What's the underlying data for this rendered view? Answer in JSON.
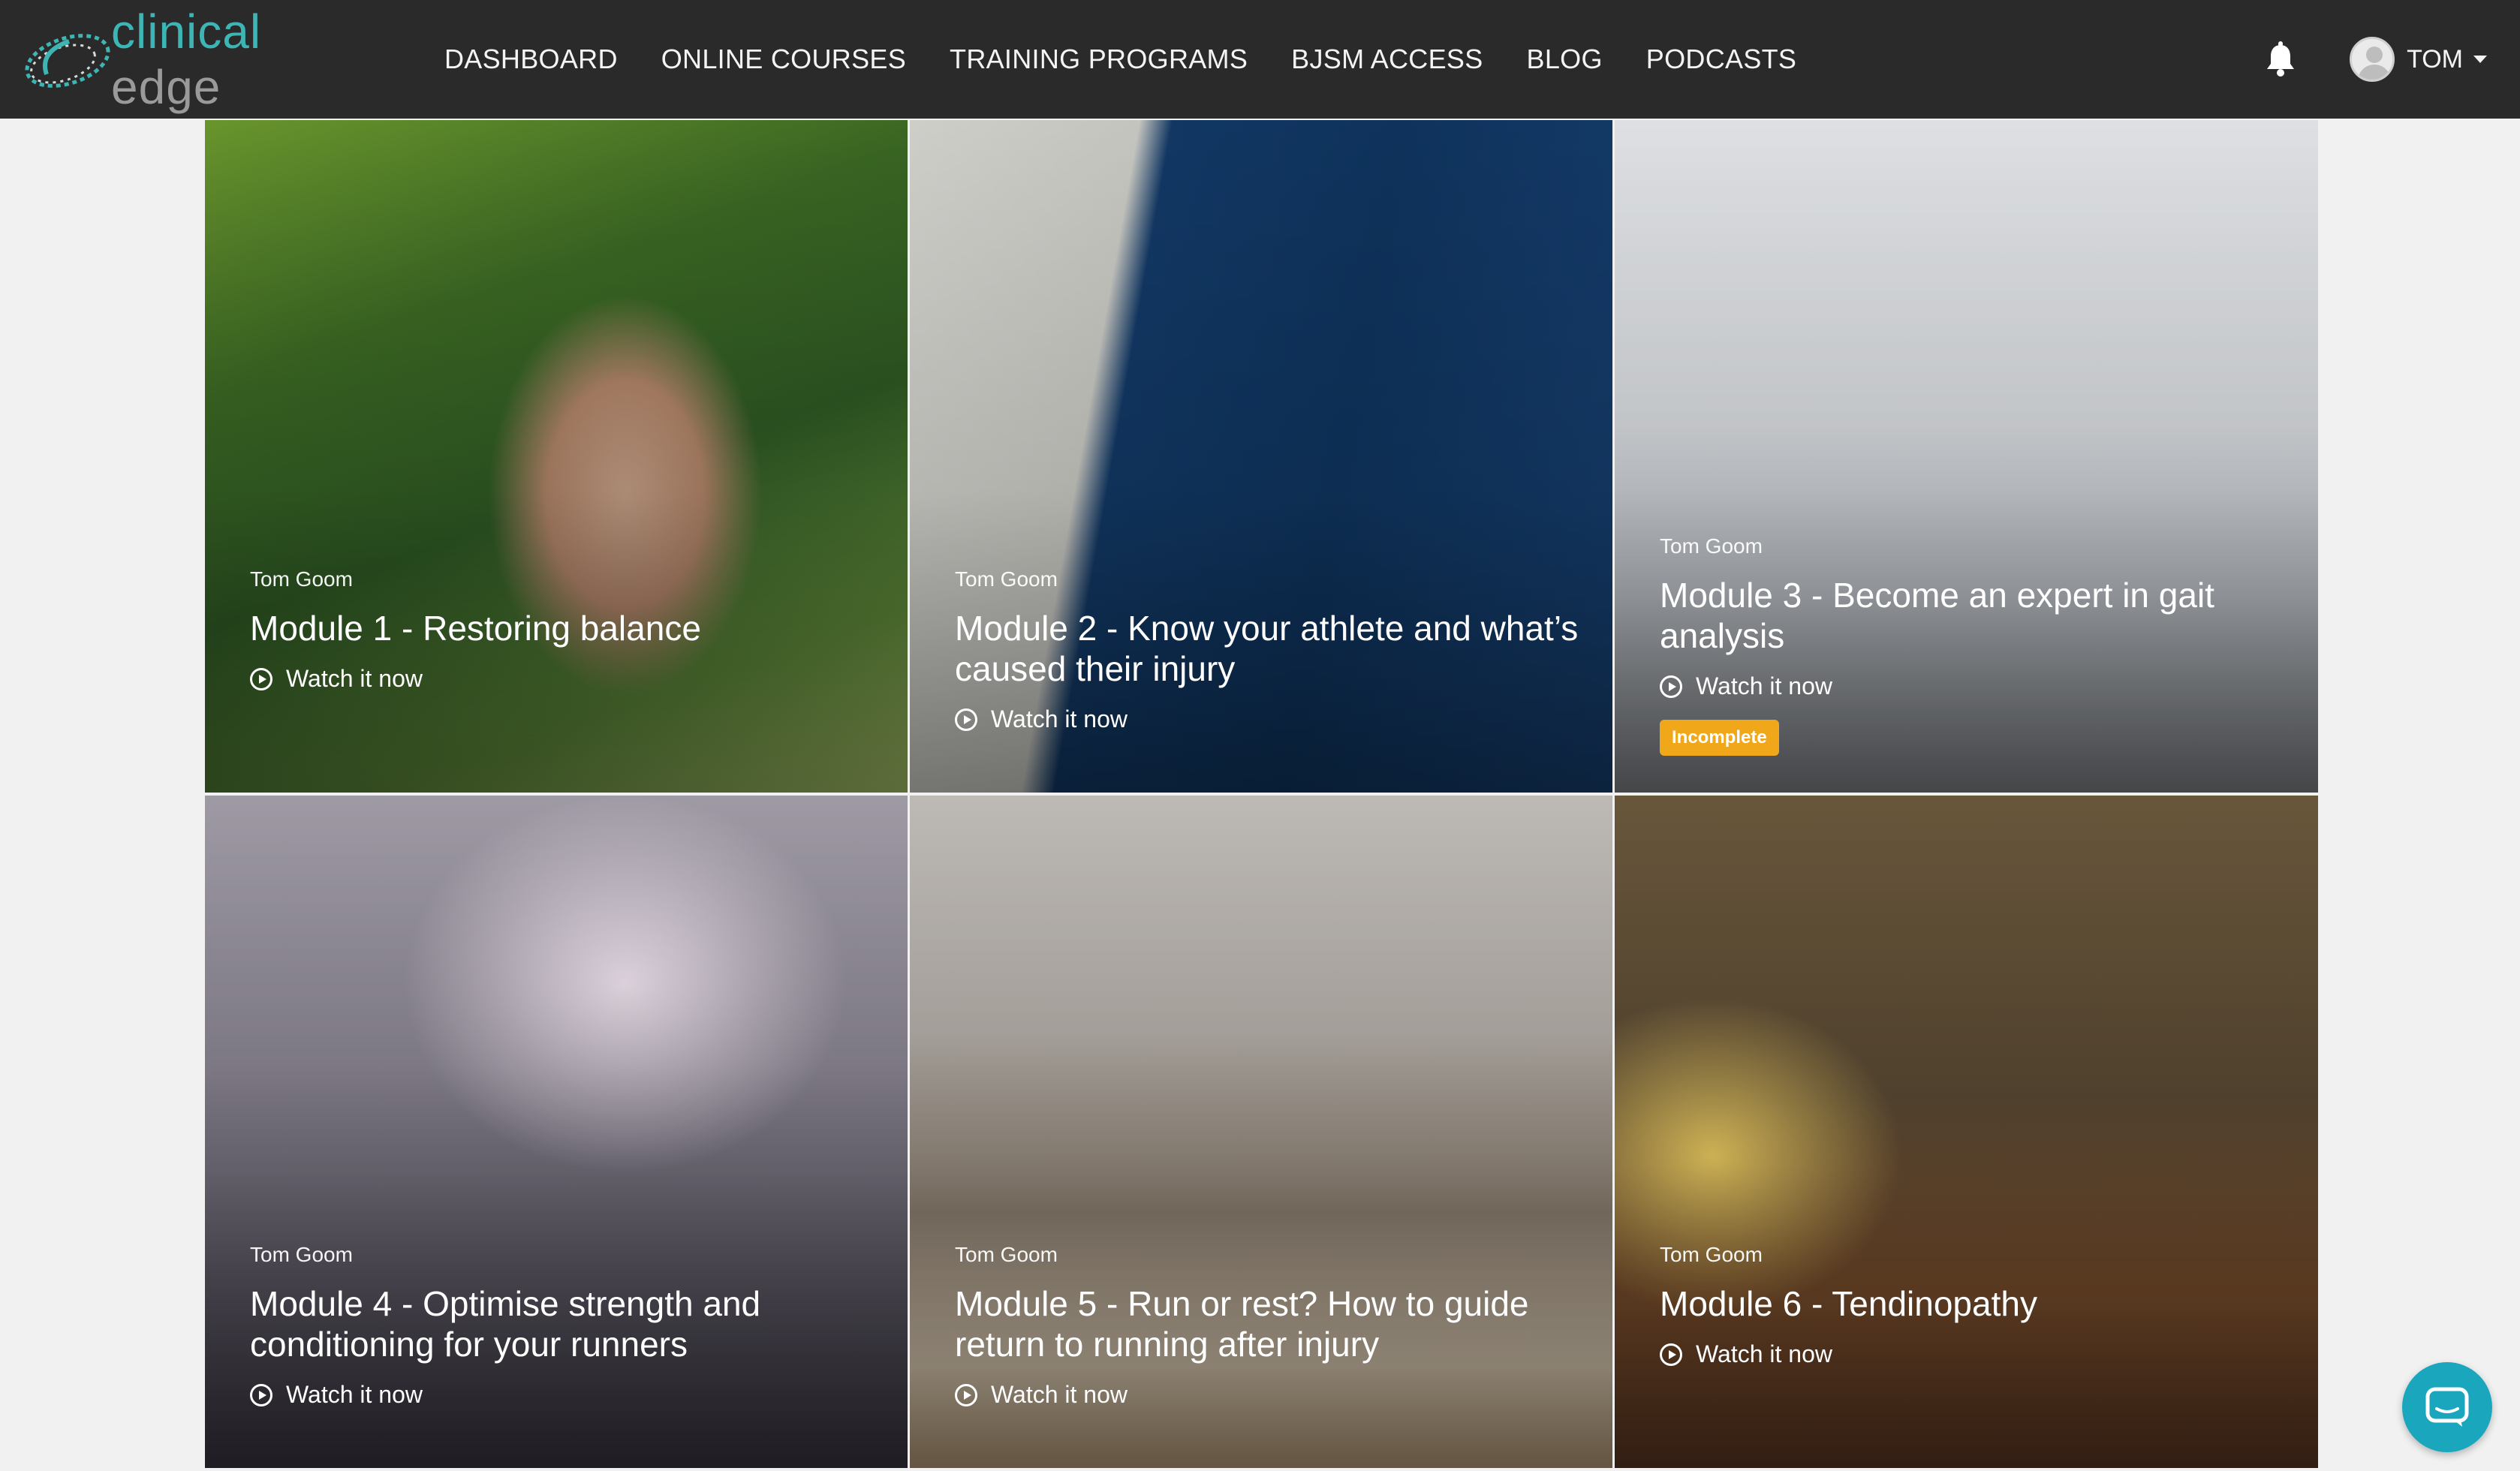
{
  "brand": {
    "name_primary": "clinical",
    "name_secondary": "edge"
  },
  "nav": {
    "items": [
      "DASHBOARD",
      "ONLINE COURSES",
      "TRAINING PROGRAMS",
      "BJSM ACCESS",
      "BLOG",
      "PODCASTS"
    ]
  },
  "user": {
    "name": "TOM"
  },
  "icons": {
    "notifications": "bell-icon",
    "chat": "chat-icon",
    "play": "play-circle-icon"
  },
  "colors": {
    "accent": "#3eb5b5",
    "badge": "#f0a81a",
    "chat": "#1aa7be",
    "navbar": "#2a2a2a"
  },
  "modules": [
    {
      "author": "Tom Goom",
      "title": "Module 1 - Restoring balance",
      "action": "Watch it now",
      "badge": ""
    },
    {
      "author": "Tom Goom",
      "title": "Module 2 - Know your athlete and what’s caused their injury",
      "action": "Watch it now",
      "badge": ""
    },
    {
      "author": "Tom Goom",
      "title": "Module 3 - Become an expert in gait analysis",
      "action": "Watch it now",
      "badge": "Incomplete"
    },
    {
      "author": "Tom Goom",
      "title": "Module 4 - Optimise strength and conditioning for your runners",
      "action": "Watch it now",
      "badge": ""
    },
    {
      "author": "Tom Goom",
      "title": "Module 5 - Run or rest? How to guide return to running after injury",
      "action": "Watch it now",
      "badge": ""
    },
    {
      "author": "Tom Goom",
      "title": "Module 6 - Tendinopathy",
      "action": "Watch it now",
      "badge": ""
    }
  ]
}
